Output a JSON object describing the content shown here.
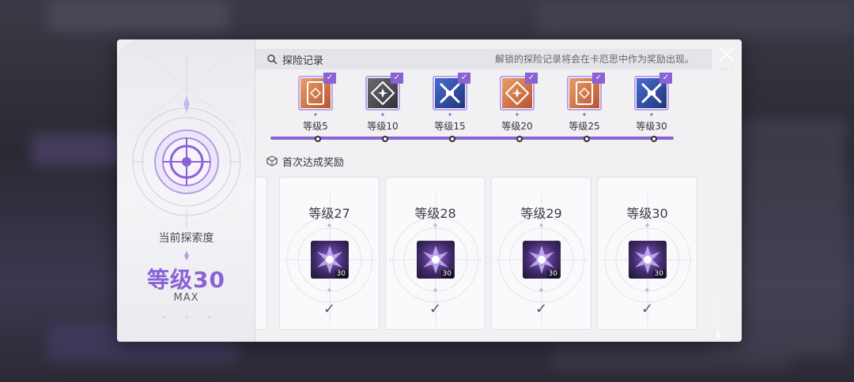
{
  "left_panel": {
    "current_label": "当前探索度",
    "current_level": "等级30",
    "max_label": "MAX"
  },
  "exploration": {
    "title": "探险记录",
    "note": "解锁的探险记录将会在卡厄思中作为奖励出现。",
    "records": [
      {
        "label": "等级5",
        "style": "orange",
        "icon": "card-diamond-icon",
        "unlocked": true
      },
      {
        "label": "等级10",
        "style": "dark",
        "icon": "diamond-star-icon",
        "unlocked": true
      },
      {
        "label": "等级15",
        "style": "blue",
        "icon": "crossed-weapons-icon",
        "unlocked": true
      },
      {
        "label": "等级20",
        "style": "orange",
        "icon": "diamond-star-icon",
        "unlocked": true
      },
      {
        "label": "等级25",
        "style": "orange",
        "icon": "card-diamond-icon",
        "unlocked": true
      },
      {
        "label": "等级30",
        "style": "blue",
        "icon": "crossed-weapons-icon",
        "unlocked": true
      }
    ],
    "progress": 1.0
  },
  "rewards": {
    "title": "首次达成奖励",
    "cards": [
      {
        "label": "等级27",
        "qty": "30",
        "claimed": true
      },
      {
        "label": "等级28",
        "qty": "30",
        "claimed": true
      },
      {
        "label": "等级29",
        "qty": "30",
        "claimed": true
      },
      {
        "label": "等级30",
        "qty": "30",
        "claimed": true
      }
    ]
  },
  "colors": {
    "accent": "#8a62d4",
    "panel": "#f1f1f3"
  },
  "controls": {
    "close_icon": "close-icon"
  }
}
